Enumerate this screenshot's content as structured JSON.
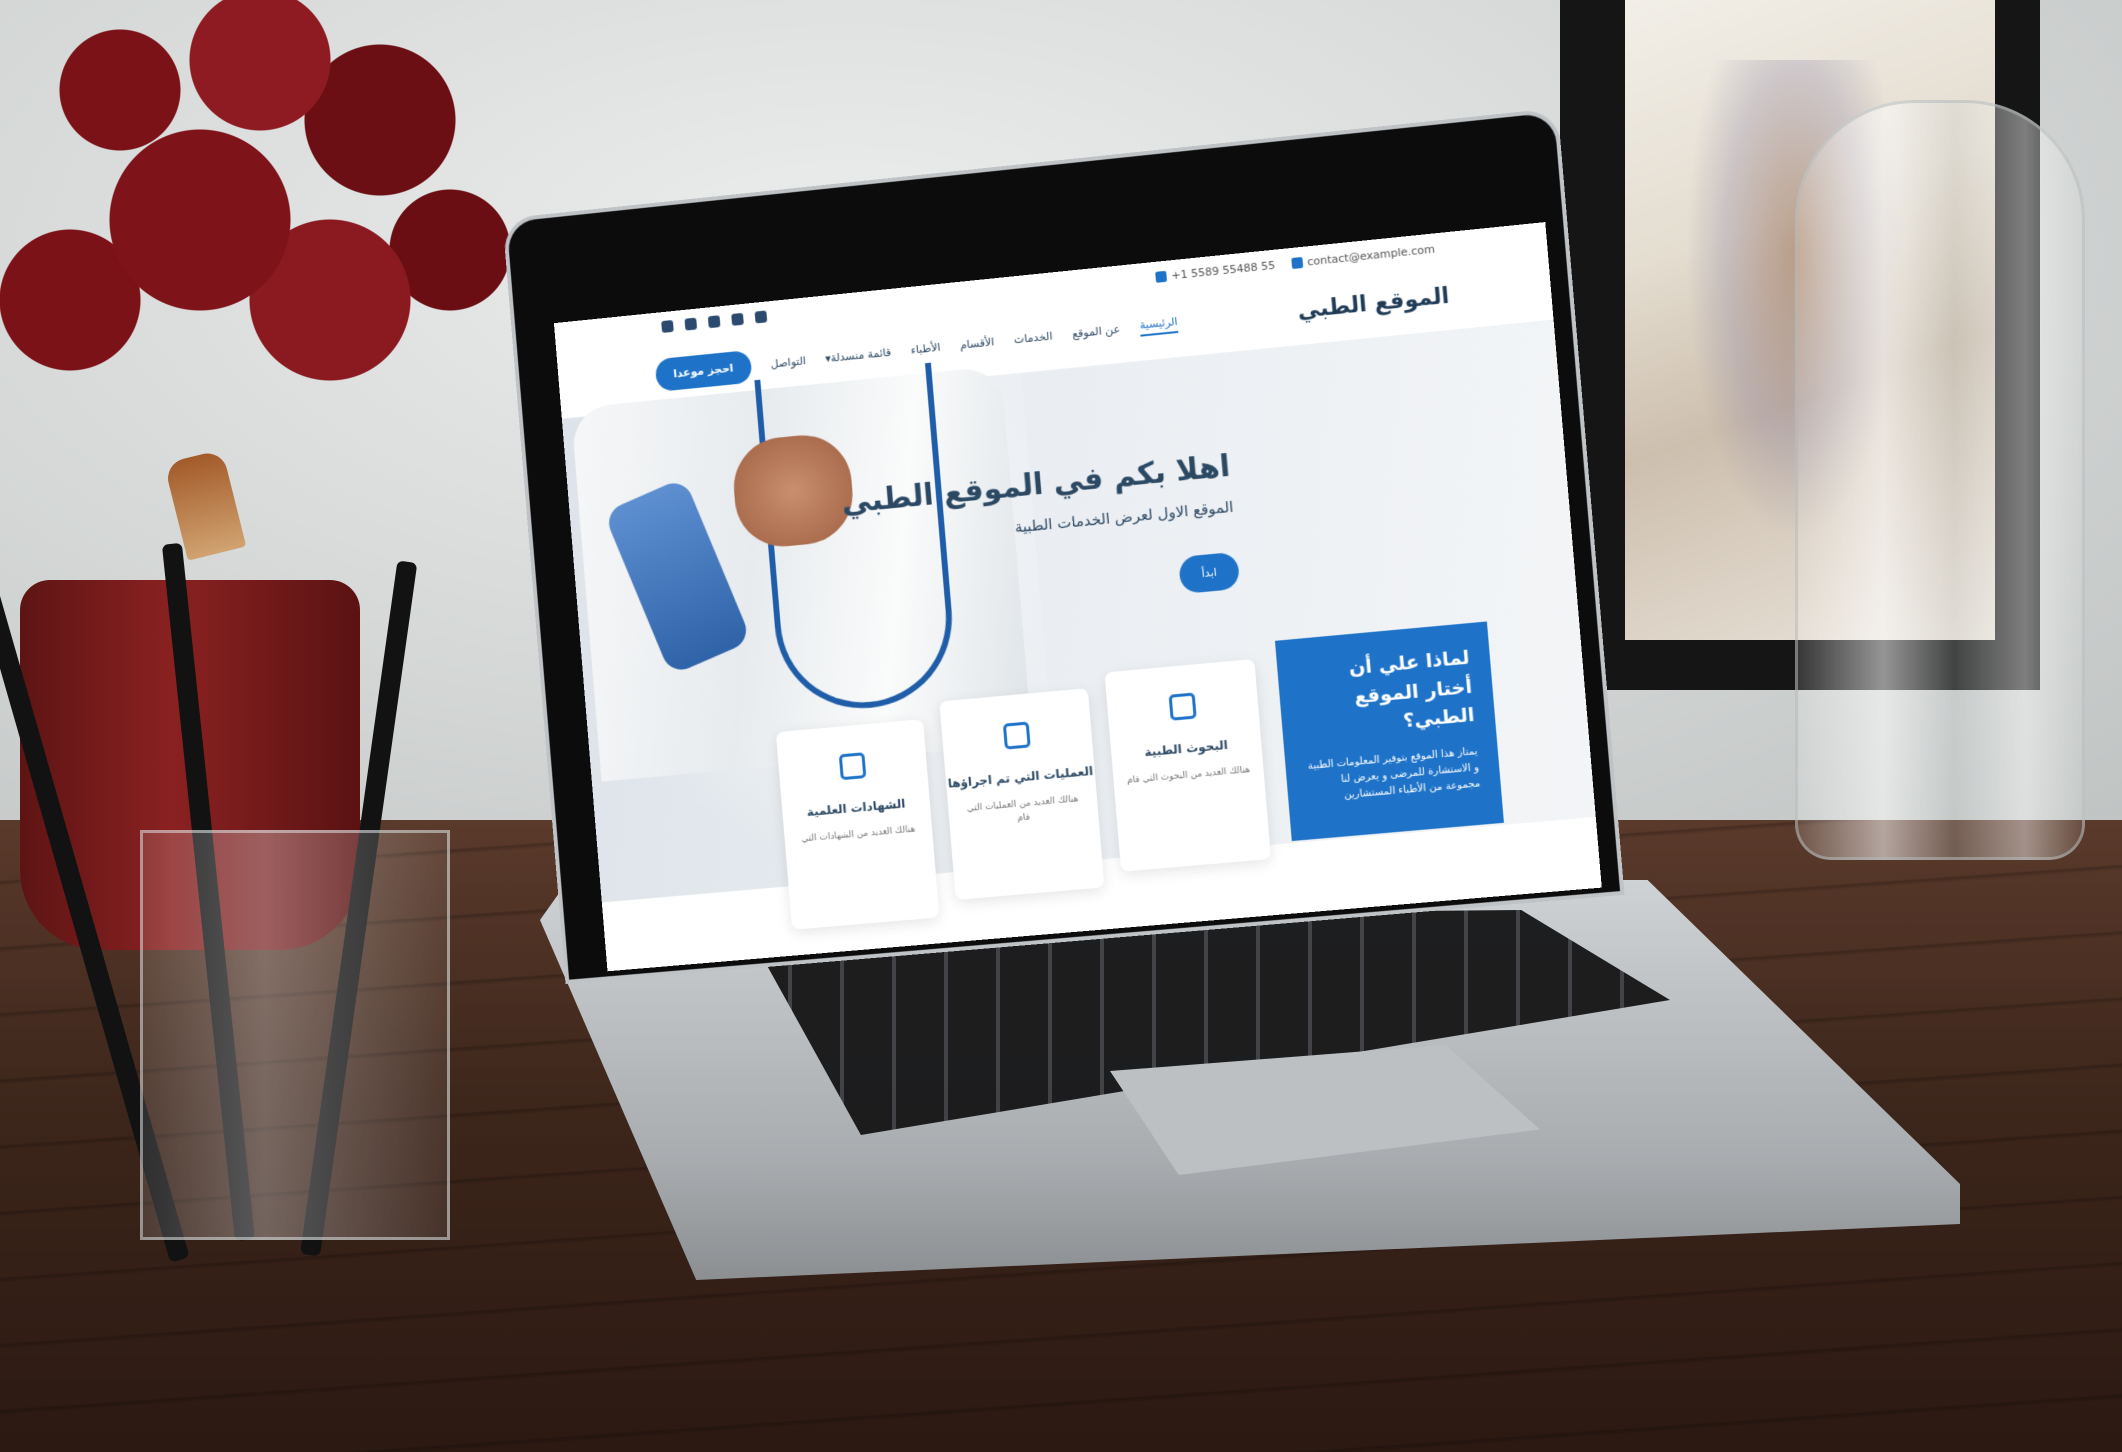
{
  "topbar": {
    "email": "contact@example.com",
    "phone": "+1 5589 55488 55",
    "social_icons": [
      "twitter-icon",
      "facebook-icon",
      "instagram-icon",
      "skype-icon",
      "linkedin-icon"
    ]
  },
  "navbar": {
    "logo": "الموقع الطبي",
    "menu": [
      "الرئيسية",
      "عن الموقع",
      "الخدمات",
      "الأقسام",
      "الأطباء",
      "قائمة منسدلة",
      "التواصل"
    ],
    "book_button": "احجز موعدا"
  },
  "hero": {
    "title": "اهلا بكم في الموقع الطبي",
    "subtitle": "الموقع الاول لعرض الخدمات الطبية",
    "start_button": "ابدأ"
  },
  "why": {
    "title": "لماذا علي أن أختار الموقع الطبي؟",
    "text": "يمتاز هذا الموقع بتوفير المعلومات الطبية و الاستشارة للمرضى و يعرض لنا مجموعة من الأطباء المستشارين"
  },
  "cards": [
    {
      "icon": "document-icon",
      "title": "البحوث الطبية",
      "text": "هنالك العديد من البحوث التي قام"
    },
    {
      "icon": "cube-icon",
      "title": "العمليات التي تم اجراؤها",
      "text": "هنالك العديد من العمليات التي قام"
    },
    {
      "icon": "image-icon",
      "title": "الشهادات العلمية",
      "text": "هنالك العديد من الشهادات التي"
    }
  ],
  "colors": {
    "accent": "#1e73c9",
    "heading": "#2c4964"
  }
}
